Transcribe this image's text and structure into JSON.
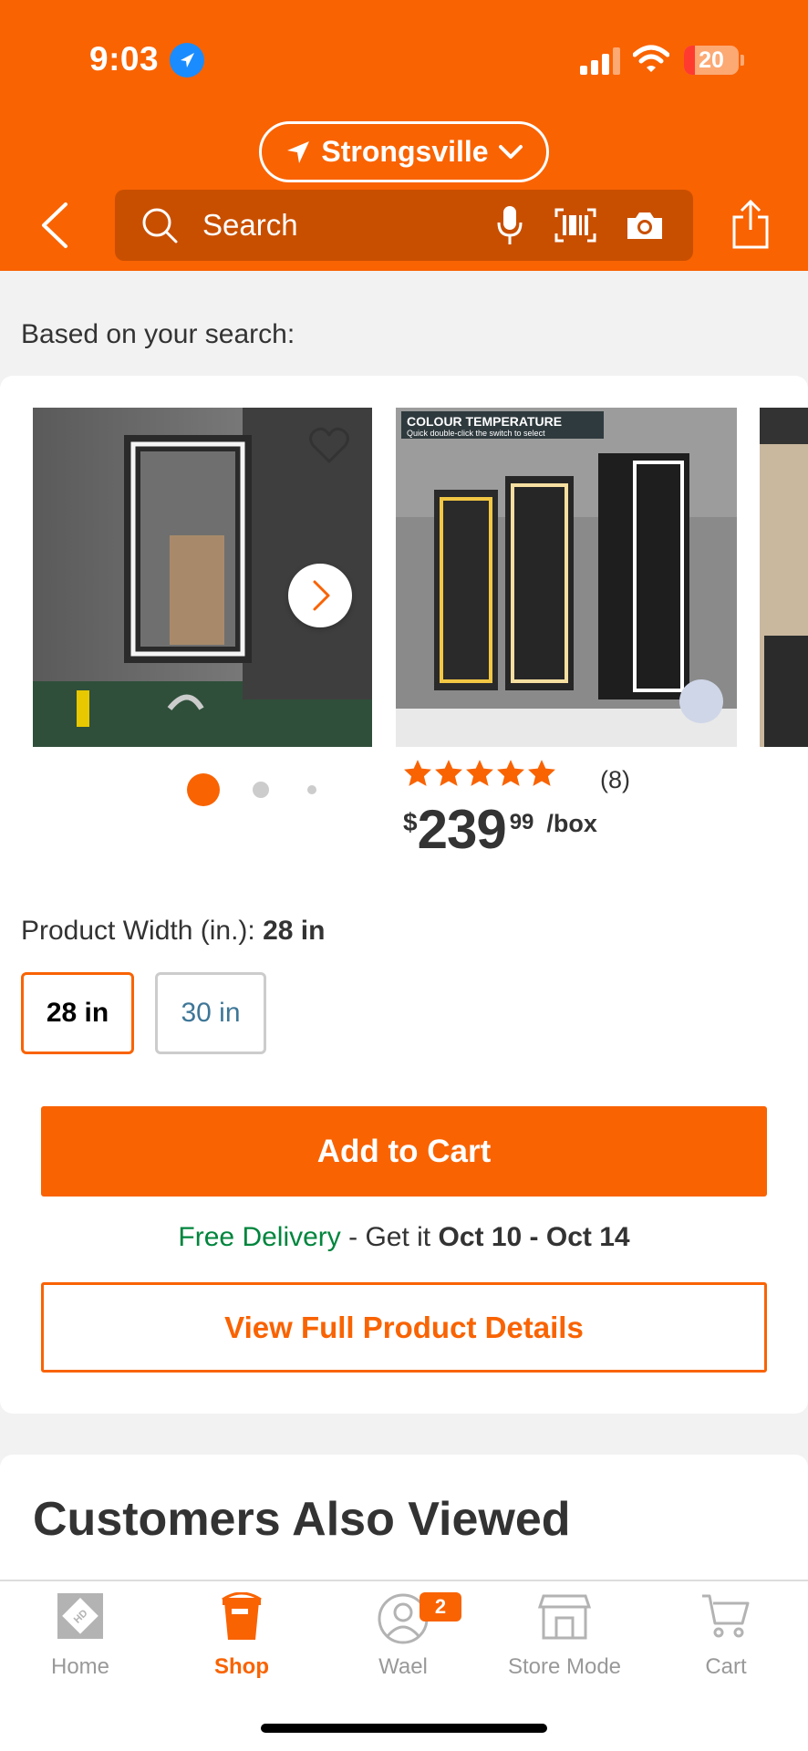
{
  "status_bar": {
    "time": "9:03",
    "battery": "20",
    "battery_level": 0.2
  },
  "header": {
    "store": "Strongsville",
    "search_placeholder": "Search"
  },
  "section_label": "Based on your search:",
  "product": {
    "image_text": {
      "heading": "COLOUR TEMPERATURE",
      "subheading": "Quick double-click the switch to select"
    },
    "rating": 5,
    "review_count": "(8)",
    "price": {
      "currency": "$",
      "dollars": "239",
      "cents": "99",
      "unit": "/box"
    },
    "width_label": "Product Width (in.): ",
    "width_selected": "28 in",
    "width_options": [
      "28 in",
      "30 in"
    ],
    "add_to_cart": "Add to Cart",
    "delivery": {
      "free": "Free Delivery",
      "middle": " - Get it ",
      "dates": "Oct 10 - Oct 14"
    },
    "view_details": "View Full Product Details",
    "carousel": {
      "current": 1,
      "total": 3
    }
  },
  "customers_also_viewed": "Customers Also Viewed",
  "bottom_nav": {
    "items": [
      {
        "label": "Home",
        "icon": "home-depot-logo-icon"
      },
      {
        "label": "Shop",
        "icon": "bucket-icon"
      },
      {
        "label": "Wael",
        "icon": "user-icon"
      },
      {
        "label": "Store Mode",
        "icon": "store-icon"
      },
      {
        "label": "Cart",
        "icon": "cart-icon"
      }
    ],
    "account_badge": "2"
  },
  "colors": {
    "brand": "#f96302",
    "link": "#3e7697",
    "success": "#00853d"
  }
}
